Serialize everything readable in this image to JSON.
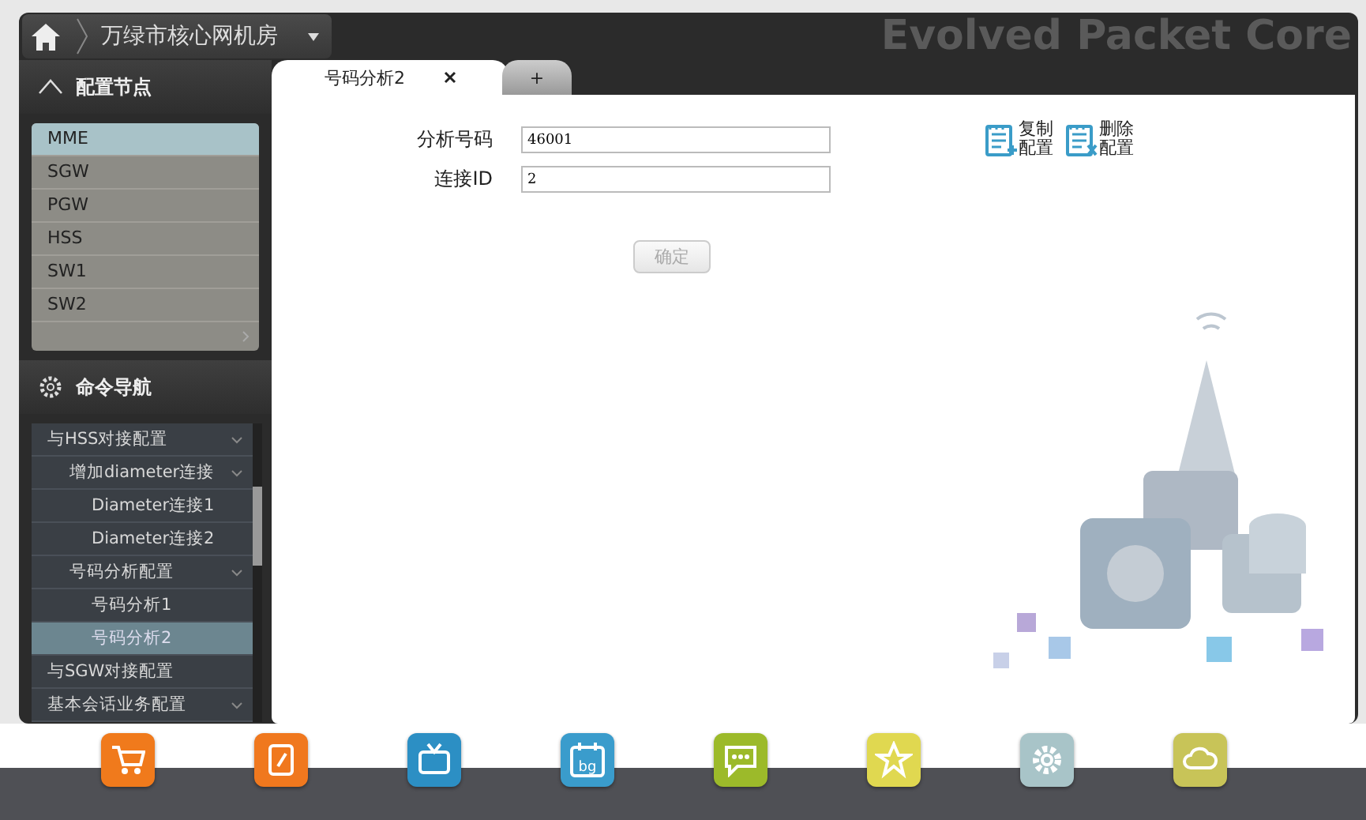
{
  "header": {
    "location": "万绿市核心网机房",
    "banner": "Evolved Packet Core"
  },
  "nodes_panel": {
    "title": "配置节点",
    "items": [
      {
        "label": "MME",
        "selected": true
      },
      {
        "label": "SGW",
        "selected": false
      },
      {
        "label": "PGW",
        "selected": false
      },
      {
        "label": "HSS",
        "selected": false
      },
      {
        "label": "SW1",
        "selected": false
      },
      {
        "label": "SW2",
        "selected": false
      }
    ]
  },
  "nav_panel": {
    "title": "命令导航",
    "tree": [
      {
        "label": "与HSS对接配置",
        "kind": "group",
        "selected": false,
        "children": [
          {
            "label": "增加diameter连接",
            "kind": "group",
            "selected": false,
            "children": [
              {
                "label": "Diameter连接1",
                "kind": "leaf",
                "selected": false
              },
              {
                "label": "Diameter连接2",
                "kind": "leaf",
                "selected": false
              }
            ]
          },
          {
            "label": "号码分析配置",
            "kind": "group",
            "selected": false,
            "children": [
              {
                "label": "号码分析1",
                "kind": "leaf",
                "selected": false
              },
              {
                "label": "号码分析2",
                "kind": "leaf",
                "selected": true
              }
            ]
          }
        ]
      },
      {
        "label": "与SGW对接配置",
        "kind": "leaf",
        "selected": false
      },
      {
        "label": "基本会话业务配置",
        "kind": "group",
        "selected": false
      }
    ]
  },
  "tabs": [
    {
      "label": "号码分析2",
      "selected": true,
      "closable": true
    },
    {
      "label": "+",
      "selected": false,
      "closable": false
    }
  ],
  "form": {
    "fields": [
      {
        "label": "分析号码",
        "value": "46001"
      },
      {
        "label": "连接ID",
        "value": "2"
      }
    ],
    "submit": {
      "label": "确定",
      "disabled": true
    }
  },
  "actions": [
    {
      "label": "复制配置",
      "kind": "copy"
    },
    {
      "label": "删除配置",
      "kind": "delete"
    }
  ],
  "dock": [
    {
      "kind": "cart",
      "color": "#f07a1c"
    },
    {
      "kind": "notebook",
      "color": "#f0781e"
    },
    {
      "kind": "tv",
      "color": "#2c8fc4"
    },
    {
      "kind": "calendar",
      "color": "#3a9ccc",
      "text": "bg"
    },
    {
      "kind": "chat",
      "color": "#9cba2a"
    },
    {
      "kind": "star",
      "color": "#e0d850"
    },
    {
      "kind": "gear",
      "color": "#a8c4c8"
    },
    {
      "kind": "cloud",
      "color": "#c8c458"
    }
  ]
}
